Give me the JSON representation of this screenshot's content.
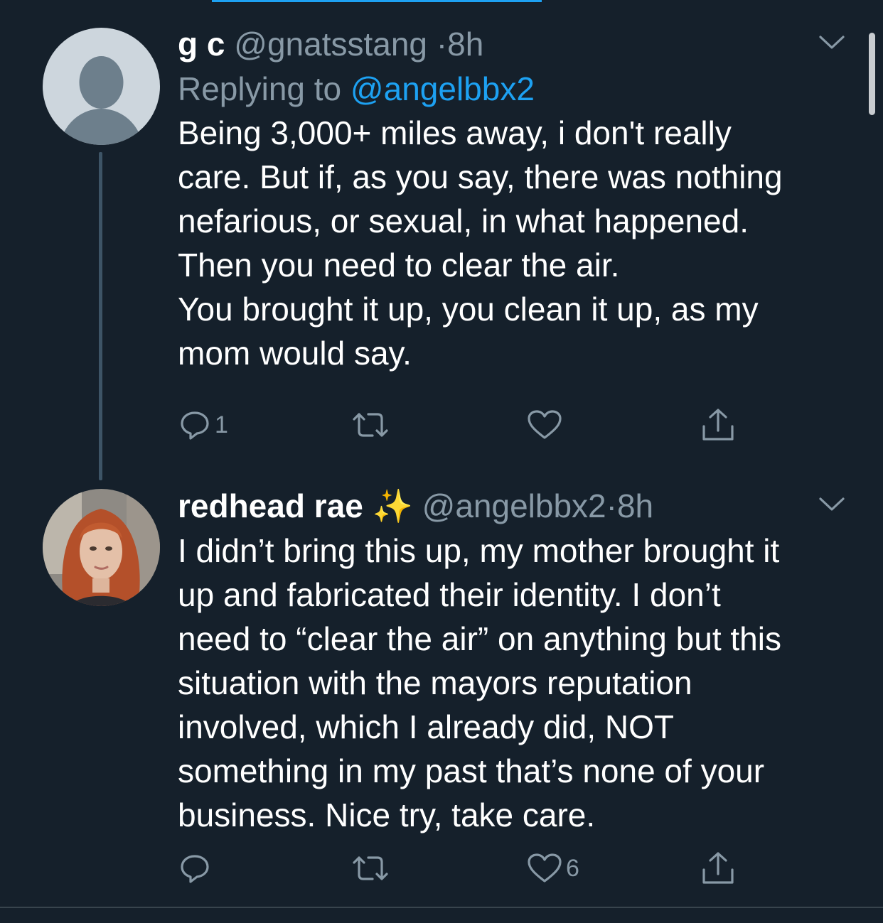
{
  "colors": {
    "background": "#15202b",
    "primary_text": "#ffffff",
    "secondary_text": "#8899a6",
    "link": "#1da1f2",
    "thread_line": "#3d5466",
    "divider": "#38444d"
  },
  "tweets": [
    {
      "display_name": "g c",
      "handle": "@gnatsstang",
      "separator": "·",
      "time": "8h",
      "replying_prefix": "Replying to",
      "replying_to": "@angelbbx2",
      "avatar_icon": "default-profile-icon",
      "text_lines": [
        "Being 3,000+ miles away, i don't really",
        "care. But if, as you say, there was nothing",
        "nefarious, or sexual, in what happened.",
        "Then you need to clear the air.",
        "You brought it up, you clean it up, as my",
        "mom would say."
      ],
      "actions": {
        "reply_count": "1",
        "retweet_count": "",
        "like_count": "",
        "share_icon": "share-icon"
      }
    },
    {
      "display_name": "redhead rae",
      "emoji": "✨",
      "handle": "@angelbbx2",
      "separator": "·",
      "time": "8h",
      "avatar_icon": "profile-photo",
      "text_lines": [
        "I didn’t bring this up, my mother brought it",
        "up and fabricated their identity. I don’t",
        "need to “clear the air” on anything but this",
        "situation with the mayors reputation",
        "involved, which I already did, NOT",
        "something in my past that’s none of your",
        "business. Nice try, take care."
      ],
      "actions": {
        "reply_count": "",
        "retweet_count": "",
        "like_count": "6",
        "share_icon": "share-icon"
      }
    }
  ]
}
